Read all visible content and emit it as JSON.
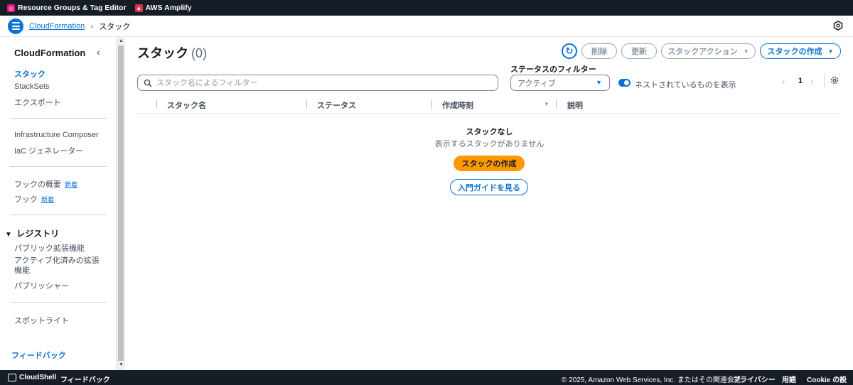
{
  "favorites": [
    {
      "label": "Resource Groups & Tag Editor",
      "icon": "resource-groups-icon",
      "color": "#e7157b"
    },
    {
      "label": "AWS Amplify",
      "icon": "amplify-icon",
      "color": "#dd344c"
    }
  ],
  "breadcrumb": {
    "root": "CloudFormation",
    "current": "スタック"
  },
  "sidebar": {
    "title": "CloudFormation",
    "items": {
      "stacks": "スタック",
      "stacksets": "StackSets",
      "exports": "エクスポート",
      "composer": "Infrastructure Composer",
      "iac_generator": "IaC ジェネレーター",
      "hooks_overview": "フックの概要",
      "hooks": "フック",
      "new_badge": "新着",
      "registry": "レジストリ",
      "public_ext": "パブリック拡張機能",
      "activated_ext": "アクティブ化済みの拡張機能",
      "publisher": "パブリッシャー",
      "spotlight": "スポットライト"
    },
    "feedback": "フィードバック"
  },
  "main": {
    "title": "スタック",
    "count": "(0)",
    "buttons": {
      "delete": "削除",
      "update": "更新",
      "stack_actions": "スタックアクション",
      "create_stack": "スタックの作成"
    },
    "filter_label": "ステータスのフィルター",
    "search_placeholder": "スタック名によるフィルター",
    "status_value": "アクティブ",
    "nested_toggle": "ネストされているものを表示",
    "page": "1",
    "columns": {
      "name": "スタック名",
      "status": "ステータス",
      "created": "作成時刻",
      "description": "説明"
    },
    "empty": {
      "title": "スタックなし",
      "subtitle": "表示するスタックがありません",
      "create": "スタックの作成",
      "guide": "入門ガイドを見る"
    }
  },
  "footer": {
    "cloudshell": "CloudShell",
    "feedback": "フィードバック",
    "copyright": "© 2025, Amazon Web Services, Inc. またはその関連会社。",
    "privacy": "プライバシー",
    "terms": "用語",
    "cookie": "Cookie の設定"
  },
  "colors": {
    "accent": "#0972d3",
    "create_button": "#ff9900",
    "header_bg": "#161d26"
  }
}
